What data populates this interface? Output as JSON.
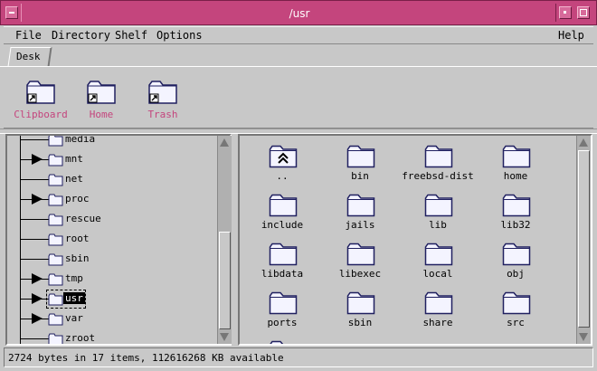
{
  "window": {
    "title": "/usr"
  },
  "menu": {
    "items": [
      "File",
      "Directory",
      "Shelf",
      "Options"
    ],
    "help": "Help"
  },
  "tabs": [
    {
      "label": "Desk"
    }
  ],
  "shelf": {
    "label_color": "#c4457d",
    "items": [
      {
        "label": "Clipboard",
        "icon": "folder-link-icon"
      },
      {
        "label": "Home",
        "icon": "folder-link-icon"
      },
      {
        "label": "Trash",
        "icon": "folder-link-icon"
      }
    ]
  },
  "tree": {
    "items": [
      {
        "label": "media",
        "expandable": false
      },
      {
        "label": "mnt",
        "expandable": true
      },
      {
        "label": "net",
        "expandable": false
      },
      {
        "label": "proc",
        "expandable": true
      },
      {
        "label": "rescue",
        "expandable": false
      },
      {
        "label": "root",
        "expandable": false
      },
      {
        "label": "sbin",
        "expandable": false
      },
      {
        "label": "tmp",
        "expandable": true
      },
      {
        "label": "usr",
        "expandable": true,
        "selected": true
      },
      {
        "label": "var",
        "expandable": true
      },
      {
        "label": "zroot",
        "expandable": false
      }
    ]
  },
  "files": {
    "items": [
      {
        "label": "..",
        "icon": "parent-folder-icon"
      },
      {
        "label": "bin",
        "icon": "folder-icon"
      },
      {
        "label": "freebsd-dist",
        "icon": "folder-icon"
      },
      {
        "label": "home",
        "icon": "folder-icon"
      },
      {
        "label": "include",
        "icon": "folder-icon"
      },
      {
        "label": "jails",
        "icon": "folder-icon"
      },
      {
        "label": "lib",
        "icon": "folder-icon"
      },
      {
        "label": "lib32",
        "icon": "folder-icon"
      },
      {
        "label": "libdata",
        "icon": "folder-icon"
      },
      {
        "label": "libexec",
        "icon": "folder-icon"
      },
      {
        "label": "local",
        "icon": "folder-icon"
      },
      {
        "label": "obj",
        "icon": "folder-icon"
      },
      {
        "label": "ports",
        "icon": "folder-icon"
      },
      {
        "label": "sbin",
        "icon": "folder-icon"
      },
      {
        "label": "share",
        "icon": "folder-icon"
      },
      {
        "label": "src",
        "icon": "folder-icon"
      }
    ]
  },
  "status": {
    "text": "2724 bytes in 17 items, 112616268 KB available"
  },
  "colors": {
    "titlebar": "#c4457d",
    "background": "#c8c8c8",
    "folder_fill": "#f4f4ff",
    "folder_stroke": "#202060"
  }
}
